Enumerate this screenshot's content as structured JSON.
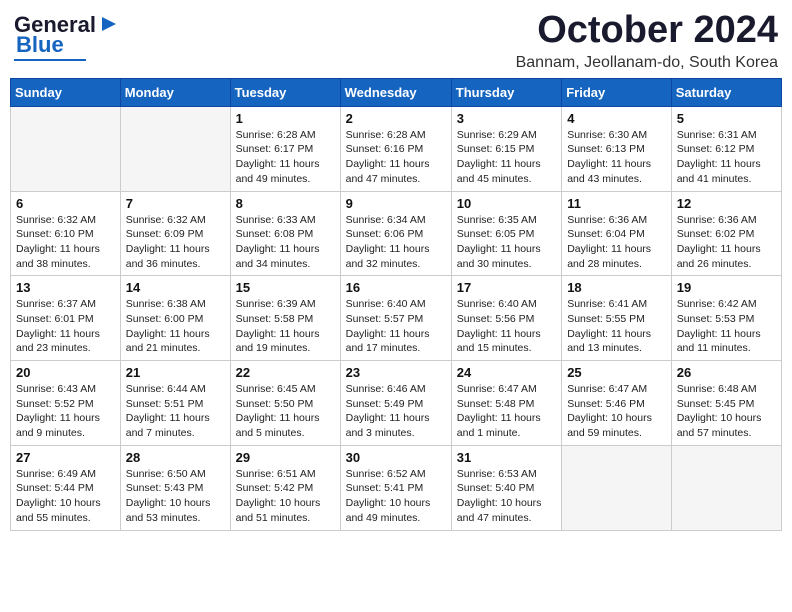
{
  "header": {
    "logo_line1": "General",
    "logo_line2": "Blue",
    "month": "October 2024",
    "location": "Bannam, Jeollanam-do, South Korea"
  },
  "days_of_week": [
    "Sunday",
    "Monday",
    "Tuesday",
    "Wednesday",
    "Thursday",
    "Friday",
    "Saturday"
  ],
  "weeks": [
    [
      {
        "day": "",
        "content": ""
      },
      {
        "day": "",
        "content": ""
      },
      {
        "day": "1",
        "content": "Sunrise: 6:28 AM\nSunset: 6:17 PM\nDaylight: 11 hours and 49 minutes."
      },
      {
        "day": "2",
        "content": "Sunrise: 6:28 AM\nSunset: 6:16 PM\nDaylight: 11 hours and 47 minutes."
      },
      {
        "day": "3",
        "content": "Sunrise: 6:29 AM\nSunset: 6:15 PM\nDaylight: 11 hours and 45 minutes."
      },
      {
        "day": "4",
        "content": "Sunrise: 6:30 AM\nSunset: 6:13 PM\nDaylight: 11 hours and 43 minutes."
      },
      {
        "day": "5",
        "content": "Sunrise: 6:31 AM\nSunset: 6:12 PM\nDaylight: 11 hours and 41 minutes."
      }
    ],
    [
      {
        "day": "6",
        "content": "Sunrise: 6:32 AM\nSunset: 6:10 PM\nDaylight: 11 hours and 38 minutes."
      },
      {
        "day": "7",
        "content": "Sunrise: 6:32 AM\nSunset: 6:09 PM\nDaylight: 11 hours and 36 minutes."
      },
      {
        "day": "8",
        "content": "Sunrise: 6:33 AM\nSunset: 6:08 PM\nDaylight: 11 hours and 34 minutes."
      },
      {
        "day": "9",
        "content": "Sunrise: 6:34 AM\nSunset: 6:06 PM\nDaylight: 11 hours and 32 minutes."
      },
      {
        "day": "10",
        "content": "Sunrise: 6:35 AM\nSunset: 6:05 PM\nDaylight: 11 hours and 30 minutes."
      },
      {
        "day": "11",
        "content": "Sunrise: 6:36 AM\nSunset: 6:04 PM\nDaylight: 11 hours and 28 minutes."
      },
      {
        "day": "12",
        "content": "Sunrise: 6:36 AM\nSunset: 6:02 PM\nDaylight: 11 hours and 26 minutes."
      }
    ],
    [
      {
        "day": "13",
        "content": "Sunrise: 6:37 AM\nSunset: 6:01 PM\nDaylight: 11 hours and 23 minutes."
      },
      {
        "day": "14",
        "content": "Sunrise: 6:38 AM\nSunset: 6:00 PM\nDaylight: 11 hours and 21 minutes."
      },
      {
        "day": "15",
        "content": "Sunrise: 6:39 AM\nSunset: 5:58 PM\nDaylight: 11 hours and 19 minutes."
      },
      {
        "day": "16",
        "content": "Sunrise: 6:40 AM\nSunset: 5:57 PM\nDaylight: 11 hours and 17 minutes."
      },
      {
        "day": "17",
        "content": "Sunrise: 6:40 AM\nSunset: 5:56 PM\nDaylight: 11 hours and 15 minutes."
      },
      {
        "day": "18",
        "content": "Sunrise: 6:41 AM\nSunset: 5:55 PM\nDaylight: 11 hours and 13 minutes."
      },
      {
        "day": "19",
        "content": "Sunrise: 6:42 AM\nSunset: 5:53 PM\nDaylight: 11 hours and 11 minutes."
      }
    ],
    [
      {
        "day": "20",
        "content": "Sunrise: 6:43 AM\nSunset: 5:52 PM\nDaylight: 11 hours and 9 minutes."
      },
      {
        "day": "21",
        "content": "Sunrise: 6:44 AM\nSunset: 5:51 PM\nDaylight: 11 hours and 7 minutes."
      },
      {
        "day": "22",
        "content": "Sunrise: 6:45 AM\nSunset: 5:50 PM\nDaylight: 11 hours and 5 minutes."
      },
      {
        "day": "23",
        "content": "Sunrise: 6:46 AM\nSunset: 5:49 PM\nDaylight: 11 hours and 3 minutes."
      },
      {
        "day": "24",
        "content": "Sunrise: 6:47 AM\nSunset: 5:48 PM\nDaylight: 11 hours and 1 minute."
      },
      {
        "day": "25",
        "content": "Sunrise: 6:47 AM\nSunset: 5:46 PM\nDaylight: 10 hours and 59 minutes."
      },
      {
        "day": "26",
        "content": "Sunrise: 6:48 AM\nSunset: 5:45 PM\nDaylight: 10 hours and 57 minutes."
      }
    ],
    [
      {
        "day": "27",
        "content": "Sunrise: 6:49 AM\nSunset: 5:44 PM\nDaylight: 10 hours and 55 minutes."
      },
      {
        "day": "28",
        "content": "Sunrise: 6:50 AM\nSunset: 5:43 PM\nDaylight: 10 hours and 53 minutes."
      },
      {
        "day": "29",
        "content": "Sunrise: 6:51 AM\nSunset: 5:42 PM\nDaylight: 10 hours and 51 minutes."
      },
      {
        "day": "30",
        "content": "Sunrise: 6:52 AM\nSunset: 5:41 PM\nDaylight: 10 hours and 49 minutes."
      },
      {
        "day": "31",
        "content": "Sunrise: 6:53 AM\nSunset: 5:40 PM\nDaylight: 10 hours and 47 minutes."
      },
      {
        "day": "",
        "content": ""
      },
      {
        "day": "",
        "content": ""
      }
    ]
  ]
}
